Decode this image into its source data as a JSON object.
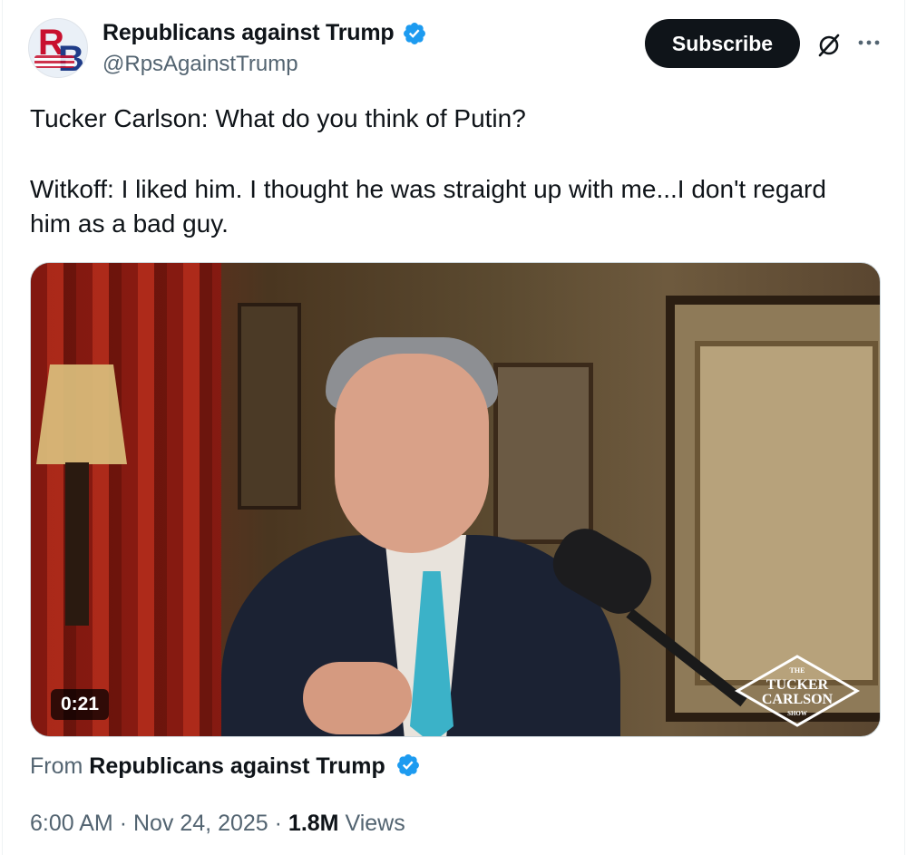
{
  "account": {
    "display_name": "Republicans against Trump",
    "handle": "@RpsAgainstTrump",
    "avatar_letters": "RB"
  },
  "actions": {
    "subscribe_label": "Subscribe",
    "grok_icon": "grok-icon",
    "more_icon": "more-icon"
  },
  "tweet": {
    "line1": "Tucker Carlson: What do you think of Putin?",
    "line2": "Witkoff: I liked him. I thought he was straight up with me...I don't regard him as a bad guy."
  },
  "media": {
    "duration": "0:21",
    "logo": {
      "top": "THE",
      "line1": "TUCKER",
      "line2": "CARLSON",
      "bottom": "SHOW"
    }
  },
  "attribution": {
    "prefix": "From",
    "source": "Republicans against Trump"
  },
  "meta": {
    "time": "6:00 AM",
    "sep1": "·",
    "date": "Nov 24, 2025",
    "sep2": "·",
    "views_count": "1.8M",
    "views_label": "Views"
  },
  "colors": {
    "verified": "#1d9bf0",
    "text": "#0f1419",
    "secondary": "#536471",
    "button_bg": "#0f1419"
  }
}
